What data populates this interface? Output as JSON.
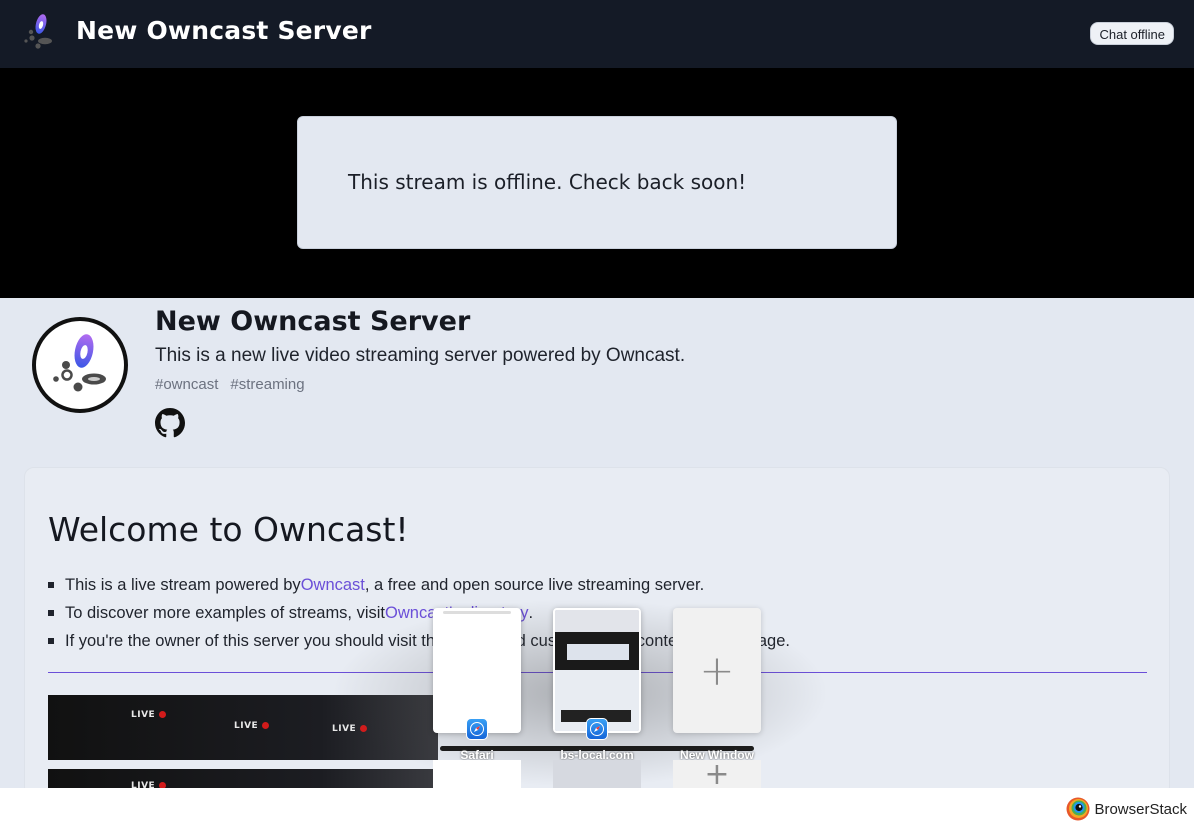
{
  "header": {
    "title": "New Owncast Server",
    "chat_status": "Chat offline"
  },
  "player": {
    "offline_message": "This stream is offline. Check back soon!"
  },
  "server": {
    "name": "New Owncast Server",
    "description": "This is a new live video streaming server powered by Owncast.",
    "tags": [
      "#owncast",
      "#streaming"
    ]
  },
  "welcome": {
    "heading": "Welcome to Owncast!",
    "line1_prefix": "This is a live stream powered by ",
    "line1_link": "Owncast",
    "line1_suffix": ", a free and open source live streaming server.",
    "line2_prefix": "To discover more examples of streams, visit ",
    "line2_link": "Owncast's directory",
    "line2_suffix": ".",
    "line3": "If you're the owner of this server you should visit the admin and customize the content on this page.",
    "banner_tags": [
      "LIVE",
      "LIVE",
      "LIVE",
      "LIVE"
    ]
  },
  "app_switcher": {
    "apps": [
      {
        "label": "Safari"
      },
      {
        "label": "bs-local.com"
      },
      {
        "label": "New Window"
      }
    ],
    "accent": "#1565d8"
  },
  "footer": {
    "brand": "BrowserStack"
  },
  "colors": {
    "header_bg": "#141a26",
    "link": "#6b4fd8",
    "content_bg": "#e3e8f1"
  }
}
